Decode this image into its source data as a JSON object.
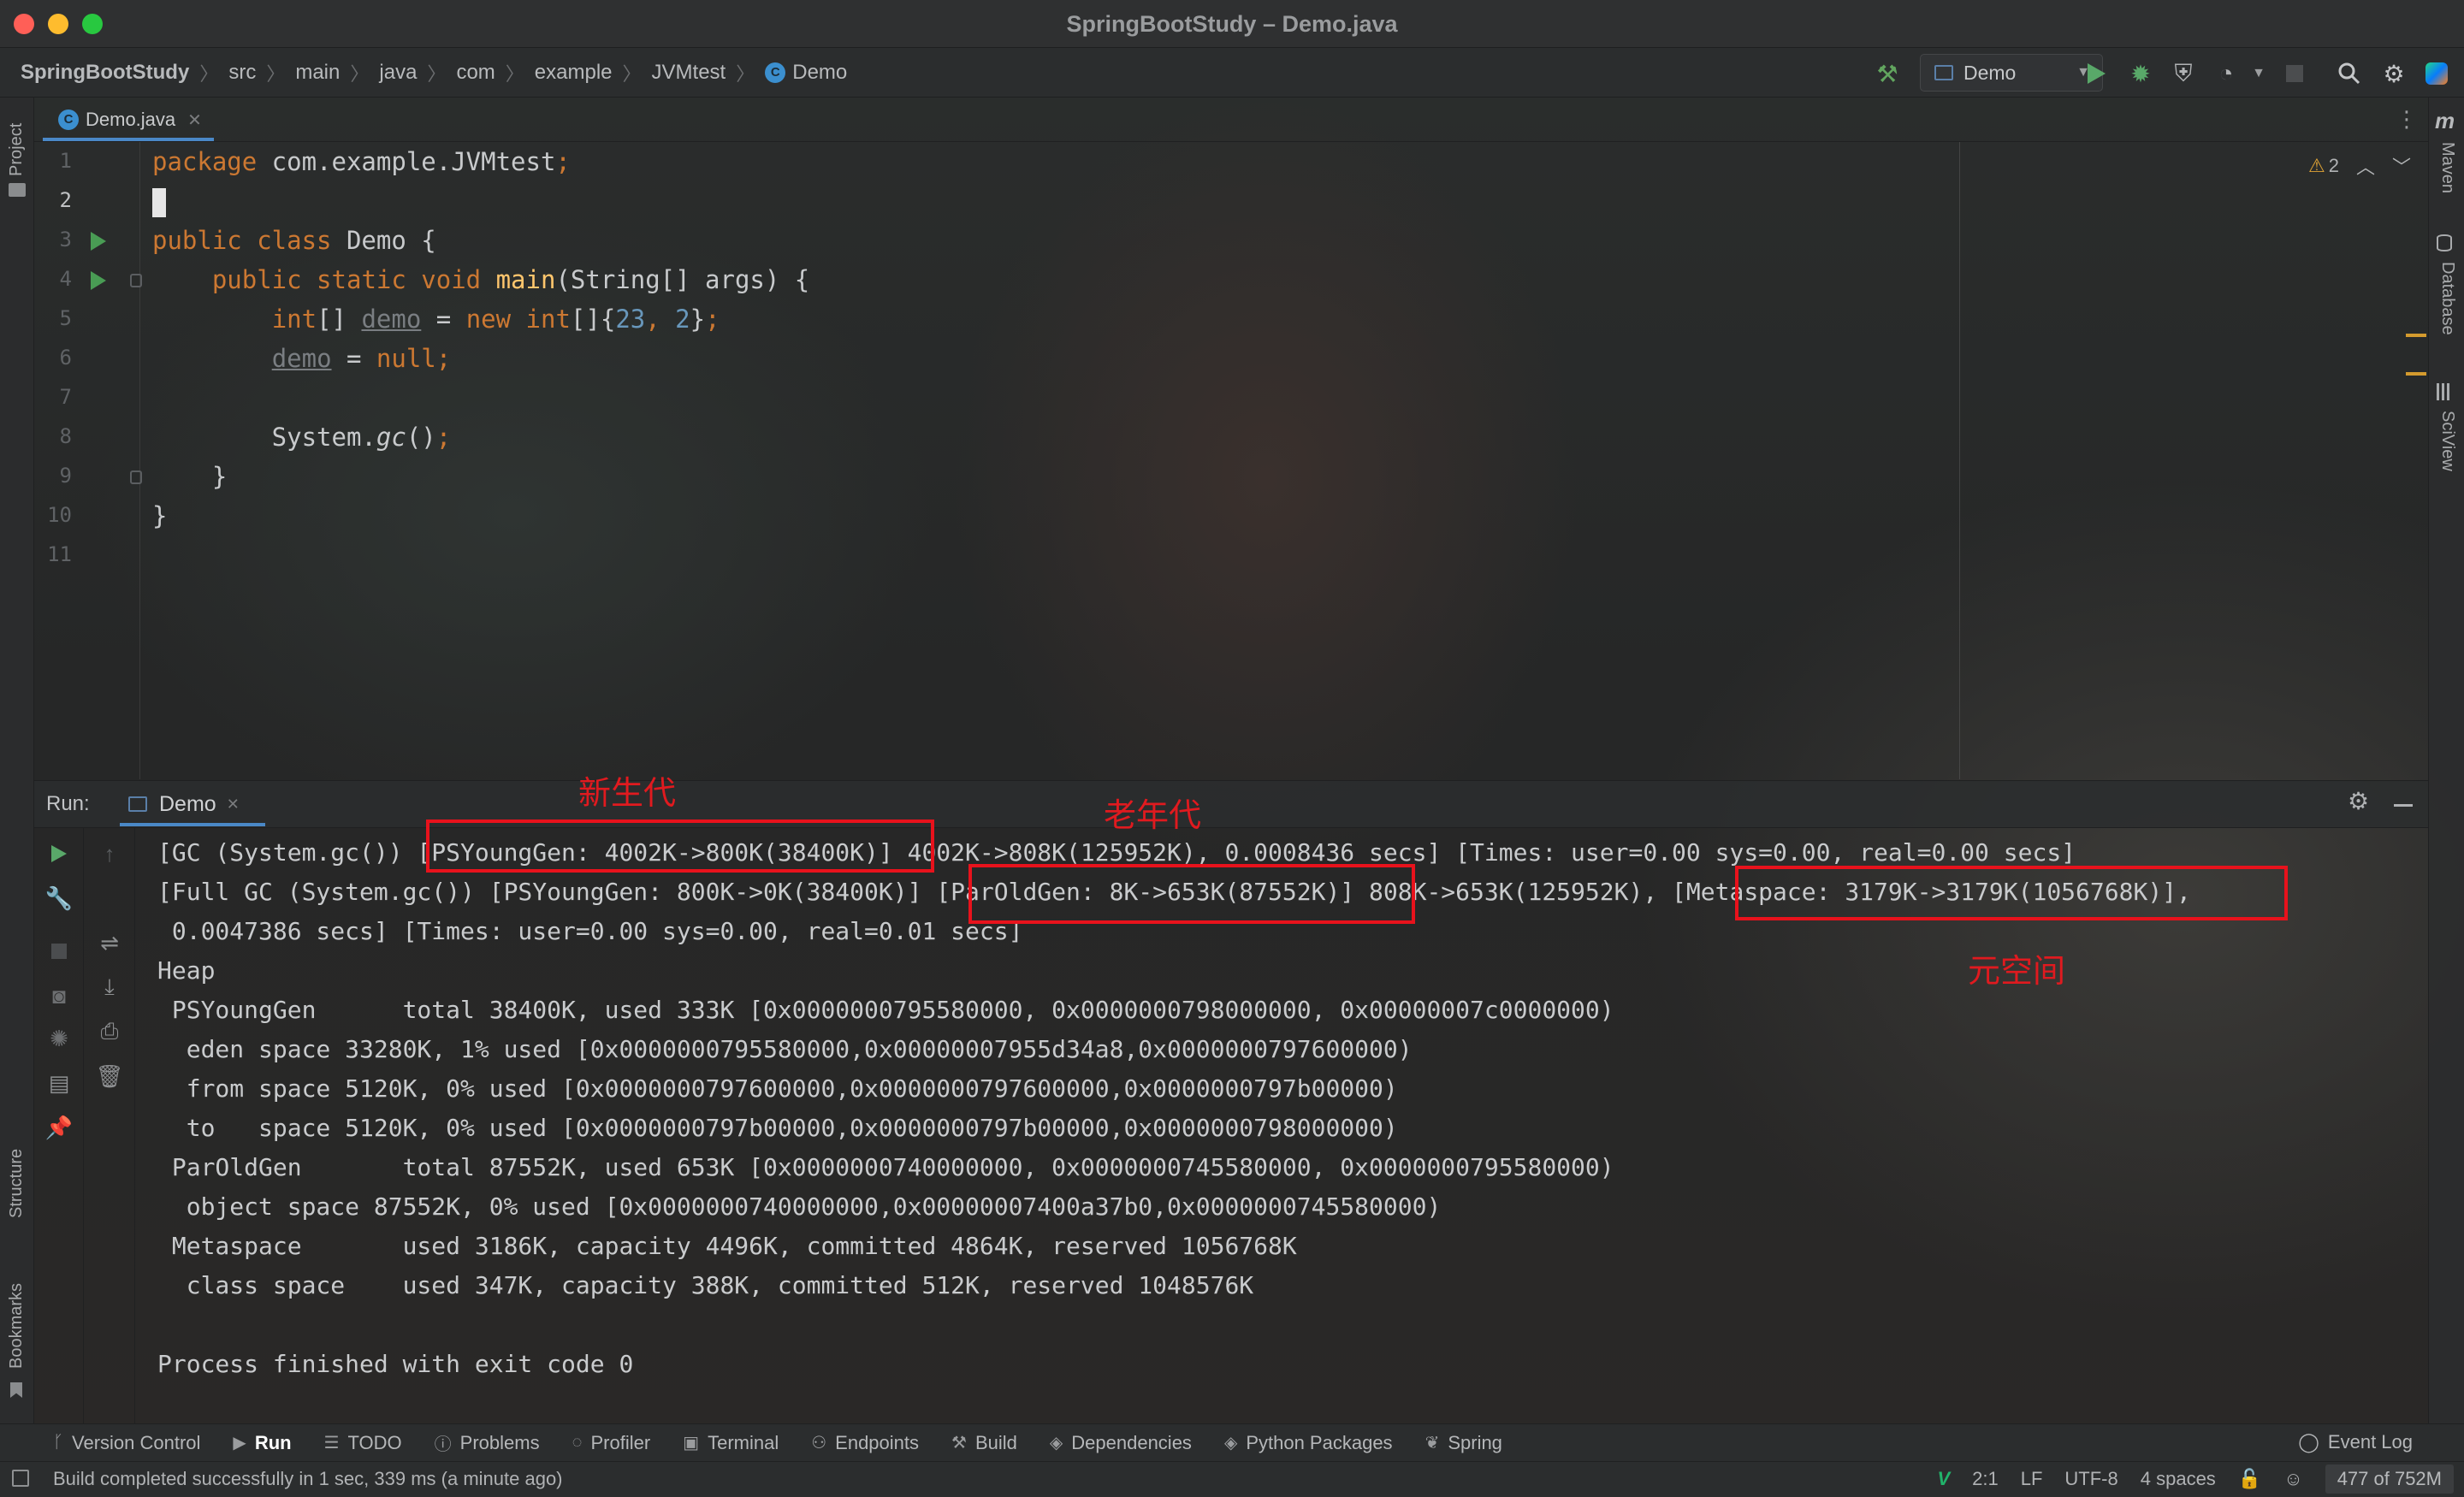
{
  "window": {
    "title": "SpringBootStudy – Demo.java"
  },
  "breadcrumbs": [
    "SpringBootStudy",
    "src",
    "main",
    "java",
    "com",
    "example",
    "JVMtest",
    "Demo"
  ],
  "toolbar": {
    "run_config": "Demo",
    "icons": [
      "hammer-build-icon",
      "run-icon",
      "debug-icon",
      "coverage-icon",
      "profile-icon",
      "stop-icon",
      "search-icon",
      "settings-icon",
      "jetbrains-icon"
    ]
  },
  "left_strip": {
    "top": "Project",
    "structure": "Structure",
    "bookmarks": "Bookmarks"
  },
  "right_strip": {
    "maven": "Maven",
    "database": "Database",
    "sciview": "SciView"
  },
  "editor": {
    "tab": "Demo.java",
    "warnings": "2",
    "line_numbers": [
      "1",
      "2",
      "3",
      "4",
      "5",
      "6",
      "7",
      "8",
      "9",
      "10",
      "11"
    ]
  },
  "run_panel": {
    "label": "Run:",
    "tab": "Demo",
    "output": [
      "[GC (System.gc()) [PSYoungGen: 4002K->800K(38400K)] 4002K->808K(125952K), 0.0008436 secs] [Times: user=0.00 sys=0.00, real=0.00 secs]",
      "[Full GC (System.gc()) [PSYoungGen: 800K->0K(38400K)] [ParOldGen: 8K->653K(87552K)] 808K->653K(125952K), [Metaspace: 3179K->3179K(1056768K)],",
      " 0.0047386 secs] [Times: user=0.00 sys=0.00, real=0.01 secs]",
      "Heap",
      " PSYoungGen      total 38400K, used 333K [0x0000000795580000, 0x0000000798000000, 0x00000007c0000000)",
      "  eden space 33280K, 1% used [0x0000000795580000,0x00000007955d34a8,0x0000000797600000)",
      "  from space 5120K, 0% used [0x0000000797600000,0x0000000797600000,0x0000000797b00000)",
      "  to   space 5120K, 0% used [0x0000000797b00000,0x0000000797b00000,0x0000000798000000)",
      " ParOldGen       total 87552K, used 653K [0x0000000740000000, 0x0000000745580000, 0x0000000795580000)",
      "  object space 87552K, 0% used [0x0000000740000000,0x00000007400a37b0,0x0000000745580000)",
      " Metaspace       used 3186K, capacity 4496K, committed 4864K, reserved 1056768K",
      "  class space    used 347K, capacity 388K, committed 512K, reserved 1048576K",
      "",
      "Process finished with exit code 0"
    ],
    "annotations": {
      "young": "新生代",
      "old": "老年代",
      "meta": "元空间"
    }
  },
  "tool_windows": [
    "Version Control",
    "Run",
    "TODO",
    "Problems",
    "Profiler",
    "Terminal",
    "Endpoints",
    "Build",
    "Dependencies",
    "Python Packages",
    "Spring"
  ],
  "event_log": "Event Log",
  "status": {
    "message": "Build completed successfully in 1 sec, 339 ms (a minute ago)",
    "position": "2:1",
    "line_sep": "LF",
    "encoding": "UTF-8",
    "indent": "4 spaces",
    "memory": "477 of 752M"
  },
  "colors": {
    "accent": "#4a88c7",
    "annotation": "#e01a1f",
    "keyword": "#cc7832",
    "number": "#6897bb",
    "run": "#499c54"
  }
}
